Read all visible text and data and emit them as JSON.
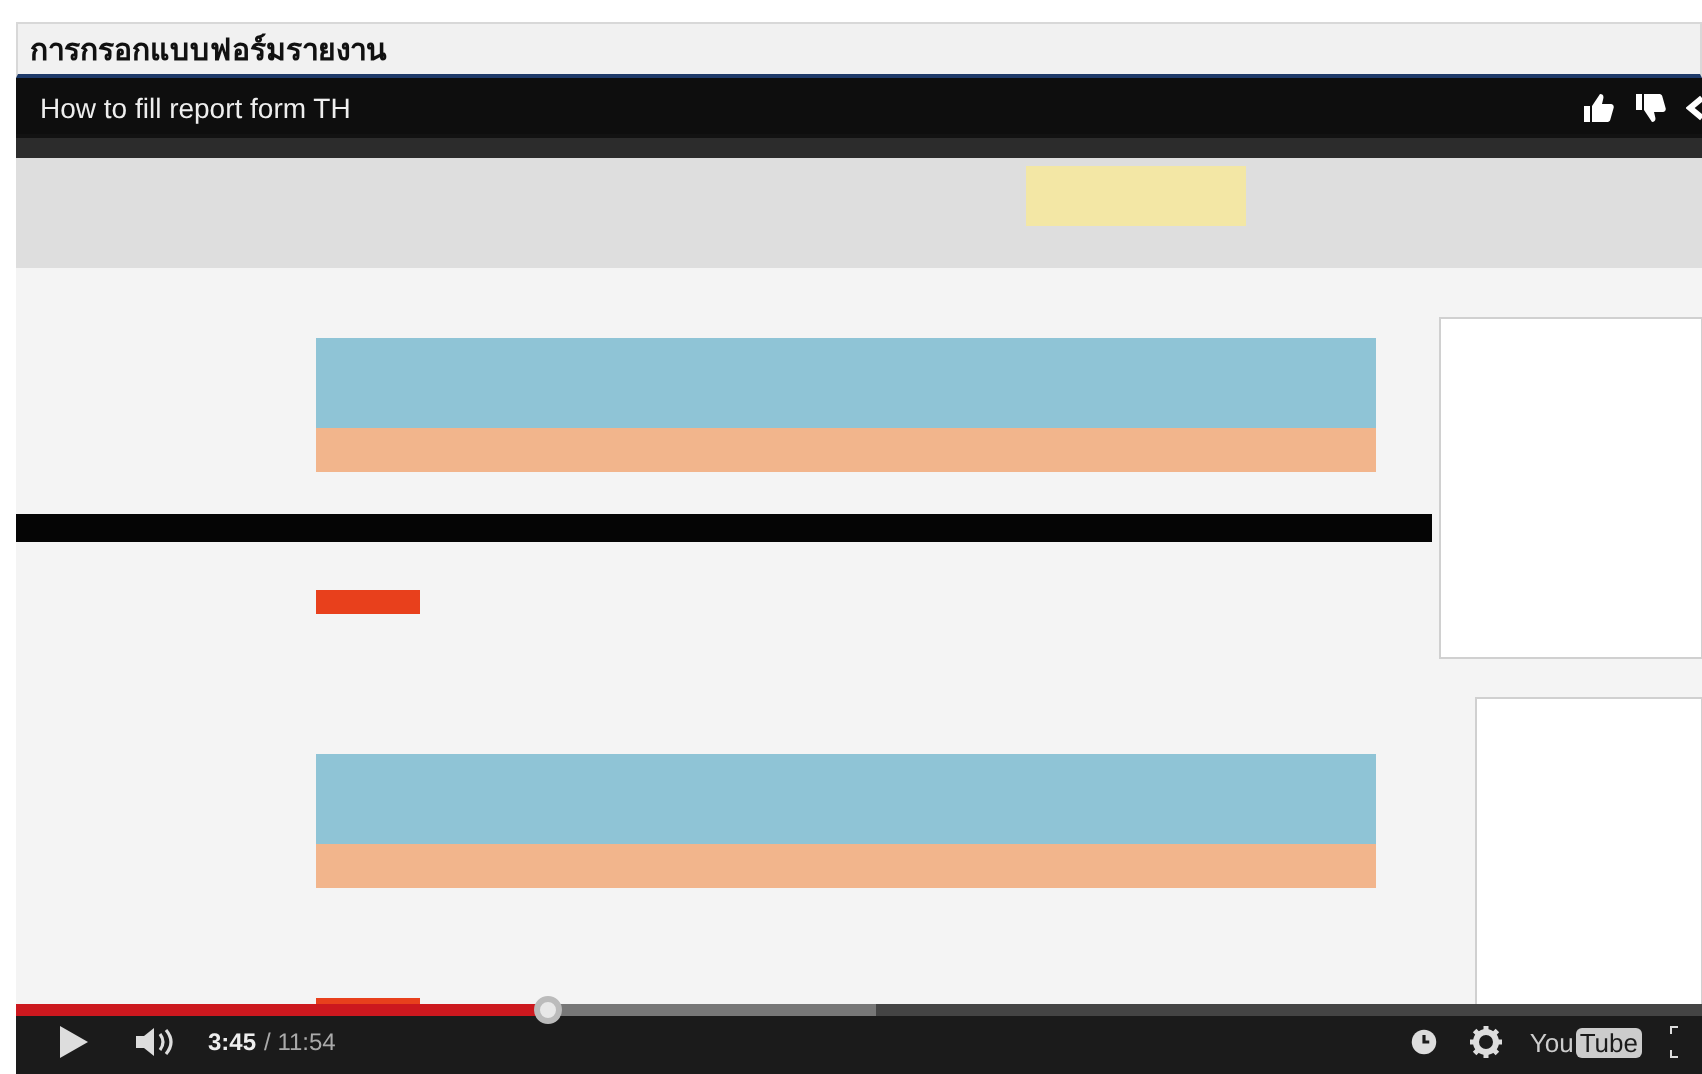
{
  "page_title": "การกรอกแบบฟอร์มรายงาน",
  "video": {
    "title": "How to fill report form TH",
    "progress": {
      "level": 0.315
    },
    "buffer": {
      "level": 0.51
    },
    "current_time": "3:45",
    "duration": "/ 11:54",
    "logo": [
      "You",
      "Tube"
    ]
  }
}
